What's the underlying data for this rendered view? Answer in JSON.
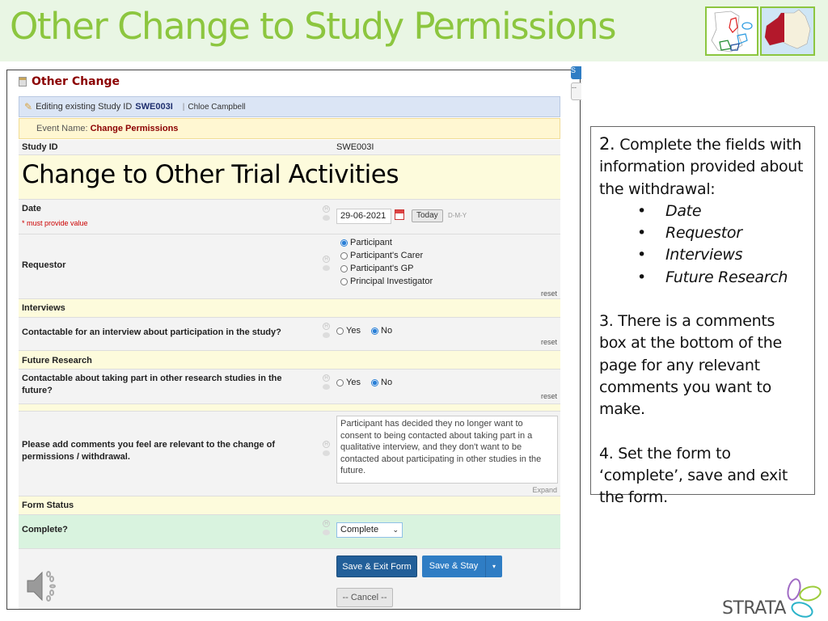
{
  "slide": {
    "title": "Other Change to Study Permissions",
    "colors": {
      "title": "#8cc63f",
      "title_bar_bg": "#e9f6e4"
    }
  },
  "form": {
    "title": "Other Change",
    "edit_bar": {
      "prefix": "Editing existing Study ID",
      "study_id": "SWE003I",
      "separator": "|",
      "user": "Chloe Campbell"
    },
    "event": {
      "label": "Event Name:",
      "value": "Change Permissions"
    },
    "side_buttons": {
      "save_partial": "S",
      "cancel_partial": "--"
    },
    "study_id_row": {
      "label": "Study ID",
      "value": "SWE003I"
    },
    "section_heading": "Change to Other Trial Activities",
    "date": {
      "label": "Date",
      "required_note": "* must provide value",
      "value": "29-06-2021",
      "today_button": "Today",
      "format": "D-M-Y"
    },
    "requestor": {
      "label": "Requestor",
      "options": [
        {
          "label": "Participant",
          "selected": true
        },
        {
          "label": "Participant's Carer",
          "selected": false
        },
        {
          "label": "Participant's GP",
          "selected": false
        },
        {
          "label": "Principal Investigator",
          "selected": false
        }
      ],
      "reset": "reset"
    },
    "interviews": {
      "header": "Interviews",
      "question": "Contactable for an interview about participation in the study?",
      "options": [
        {
          "label": "Yes",
          "selected": false
        },
        {
          "label": "No",
          "selected": true
        }
      ],
      "reset": "reset"
    },
    "future_research": {
      "header": "Future Research",
      "question": "Contactable about taking part in other research studies in the future?",
      "options": [
        {
          "label": "Yes",
          "selected": false
        },
        {
          "label": "No",
          "selected": true
        }
      ],
      "reset": "reset"
    },
    "comments": {
      "label": "Please add comments you feel are relevant to the change of permissions / withdrawal.",
      "value": "Participant has decided they no longer want to consent to being contacted about taking part in a qualitative interview, and they don't want to be contacted about participating in other studies in the future.",
      "expand": "Expand"
    },
    "form_status": {
      "header": "Form Status",
      "label": "Complete?",
      "selected": "Complete"
    },
    "buttons": {
      "save_exit": "Save & Exit Form",
      "save_stay": "Save & Stay",
      "dropdown": "▾",
      "cancel": "-- Cancel --"
    }
  },
  "instructions": {
    "step2_num": "2.",
    "step2_text": "Complete the fields with information provided about the withdrawal:",
    "items": [
      "Date",
      "Requestor",
      "Interviews",
      "Future Research"
    ],
    "step3": "3. There is a comments box at the bottom of the page for any relevant comments you want to make.",
    "step4": "4. Set the form to ‘complete’, save and exit the form."
  },
  "logo": {
    "text": "STRATA"
  }
}
